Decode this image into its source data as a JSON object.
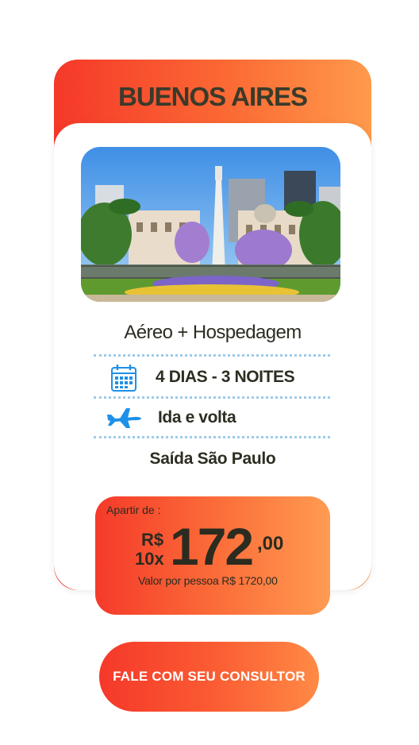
{
  "destination": {
    "title": "BUENOS AIRES"
  },
  "package": {
    "type": "Aéreo + Hospedagem",
    "duration": "4 DIAS - 3 NOITES",
    "flight": "Ida e volta",
    "departure": "Saída São Paulo"
  },
  "price": {
    "from_label": "Apartir de :",
    "currency": "R$",
    "installments": "10x",
    "amount": "172",
    "cents": ",00",
    "per_person": "Valor por pessoa R$ 1720,00"
  },
  "cta": {
    "label": "FALE COM SEU CONSULTOR"
  },
  "icons": {
    "duration": "calendar-icon",
    "flight": "airplane-icon"
  },
  "colors": {
    "accent_start": "#f5382a",
    "accent_end": "#ff9a4b",
    "dotted_divider": "#9ccbe9",
    "icon_blue": "#1e90e8",
    "text_dark": "#2d2d22"
  }
}
